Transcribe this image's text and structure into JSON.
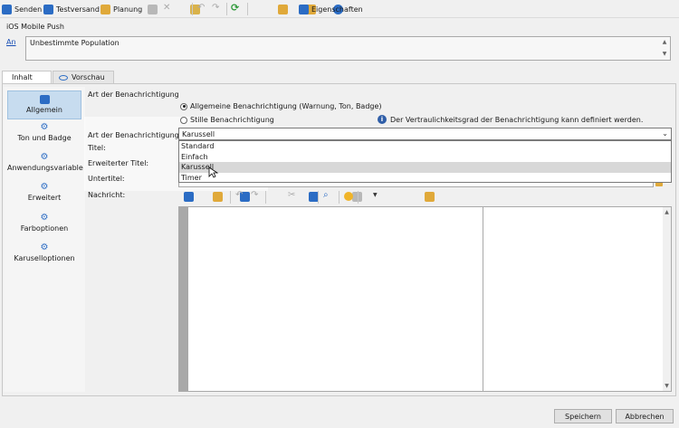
{
  "toolbar": {
    "send_label": "Senden",
    "test_send_label": "Testversand",
    "planning_label": "Planung",
    "properties_label": "Eigenschaften"
  },
  "header": {
    "section_title": "iOS Mobile Push",
    "an_link": "An",
    "population": "Unbestimmte Population"
  },
  "tabs": {
    "content_label": "Inhalt",
    "preview_label": "Vorschau"
  },
  "sidebar": {
    "items": [
      {
        "label": "Allgemein",
        "icon": "general-icon"
      },
      {
        "label": "Ton und Badge",
        "icon": "gear-icon"
      },
      {
        "label": "Anwendungsvariable",
        "icon": "gear-icon"
      },
      {
        "label": "Erweitert",
        "icon": "gear-icon"
      },
      {
        "label": "Farboptionen",
        "icon": "gear-icon"
      },
      {
        "label": "Karuselloptionen",
        "icon": "gear-icon"
      }
    ]
  },
  "form": {
    "group_title": "Art der Benachrichtigung",
    "radio_general": "Allgemeine Benachrichtigung (Warnung, Ton, Badge)",
    "radio_silent": "Stille Benachrichtigung",
    "info_text": "Der Vertraulichkeitsgrad der Benachrichtigung kann definiert werden.",
    "type_label": "Art der Benachrichtigung:",
    "type_value": "Karussell",
    "type_options": [
      "Standard",
      "Einfach",
      "Karussell",
      "Timer"
    ],
    "title_label": "Titel:",
    "ext_title_label": "Erweiterter Titel:",
    "subtitle_label": "Untertitel:",
    "message_label": "Nachricht:"
  },
  "buttons": {
    "save": "Speichern",
    "cancel": "Abbrechen"
  }
}
